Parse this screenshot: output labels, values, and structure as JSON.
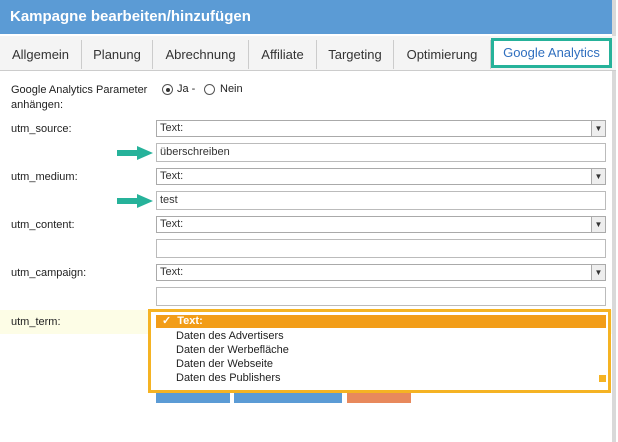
{
  "window": {
    "title": "Kampagne bearbeiten/hinzufügen"
  },
  "tabs": [
    {
      "label": "Allgemein"
    },
    {
      "label": "Planung"
    },
    {
      "label": "Abrechnung"
    },
    {
      "label": "Affiliate"
    },
    {
      "label": "Targeting"
    },
    {
      "label": "Optimierung"
    },
    {
      "label": "Google Analytics"
    }
  ],
  "ga": {
    "append_label": "Google Analytics Parameter anhängen:",
    "option_yes": "Ja -",
    "option_no": "Nein",
    "selected": "Ja -"
  },
  "fields": {
    "source": {
      "label": "utm_source:",
      "select": "Text:",
      "value": "überschreiben"
    },
    "medium": {
      "label": "utm_medium:",
      "select": "Text:",
      "value": "test"
    },
    "content": {
      "label": "utm_content:",
      "select": "Text:",
      "value": ""
    },
    "campaign": {
      "label": "utm_campaign:",
      "select": "Text:",
      "value": ""
    },
    "term": {
      "label": "utm_term:",
      "select": "Text:"
    }
  },
  "term_dropdown": {
    "selected": "Text:",
    "options": [
      "Daten des Advertisers",
      "Daten der Werbefläche",
      "Daten der Webseite",
      "Daten des Publishers"
    ]
  },
  "colors": {
    "titlebar": "#5b9bd5",
    "active_tab_border": "#26b29a",
    "arrow": "#26b29a",
    "dropdown_highlight": "#f5b323"
  }
}
